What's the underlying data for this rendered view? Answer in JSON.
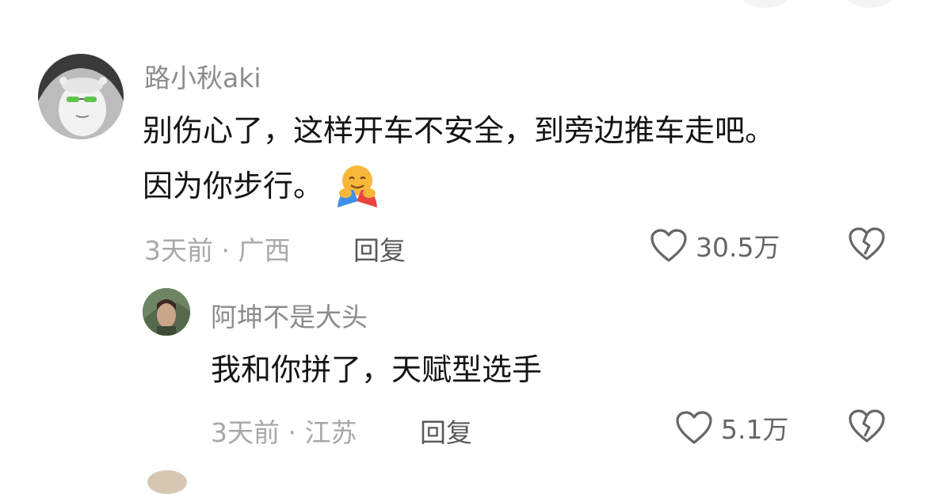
{
  "comments": [
    {
      "username": "路小秋aki",
      "text_line1": "别伤心了，这样开车不安全，到旁边推车走吧。",
      "text_line2": "因为你步行。",
      "emoji": "hugging-face-emoji",
      "meta": "3天前 · 广西",
      "reply_label": "回复",
      "likes": "30.5万"
    },
    {
      "username": "阿坤不是大头",
      "text": "我和你拼了，天赋型选手",
      "meta": "3天前 · 江苏",
      "reply_label": "回复",
      "likes": "5.1万"
    }
  ],
  "icons": {
    "like": "heart-outline-icon",
    "dislike": "broken-heart-icon"
  },
  "colors": {
    "username": "#8c8c8c",
    "body_text": "#141414",
    "meta": "#a8a8a8",
    "icon": "#666666"
  }
}
